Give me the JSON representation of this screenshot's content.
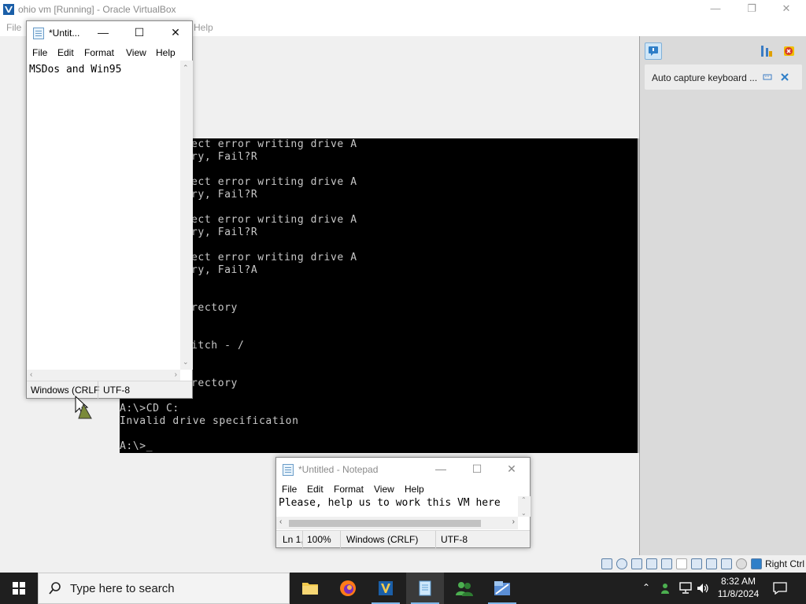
{
  "vbox": {
    "title": "ohio vm [Running] - Oracle VirtualBox",
    "menu": {
      "file": "File",
      "help": "Help"
    },
    "status": {
      "host_key": "Right Ctrl"
    }
  },
  "dos": {
    "lines": [
      "ect error writing drive A",
      "ry, Fail?R",
      "",
      "ect error writing drive A",
      "ry, Fail?R",
      "",
      "ect error writing drive A",
      "ry, Fail?R",
      "",
      "ect error writing drive A",
      "ry, Fail?A",
      "",
      "",
      "rectory",
      "",
      "",
      "itch - /",
      "",
      "",
      "rectory",
      "",
      "A:\\>CD C:",
      "Invalid drive specification",
      "",
      "A:\\>_"
    ]
  },
  "side_panel": {
    "notification": "Auto capture keyboard ..."
  },
  "notepad_left": {
    "title": "*Untit...",
    "menu": [
      "File",
      "Edit",
      "Format",
      "View",
      "Help"
    ],
    "content": "MSDos and Win95",
    "status": {
      "line_ending": "Windows (CRLF",
      "encoding": "UTF-8"
    }
  },
  "notepad_right": {
    "title": "*Untitled - Notepad",
    "menu": [
      "File",
      "Edit",
      "Format",
      "View",
      "Help"
    ],
    "content": "Please, help us to work this VM here",
    "status": {
      "position": "Ln 1,",
      "zoom": "100%",
      "line_ending": "Windows (CRLF)",
      "encoding": "UTF-8"
    }
  },
  "taskbar": {
    "search_placeholder": "Type here to search",
    "time": "8:32 AM",
    "date": "11/8/2024"
  },
  "colors": {
    "taskbar_bg": "#1f1f1f",
    "dos_bg": "#000000",
    "dos_fg": "#c8c8c8",
    "accent": "#7db6e8"
  }
}
